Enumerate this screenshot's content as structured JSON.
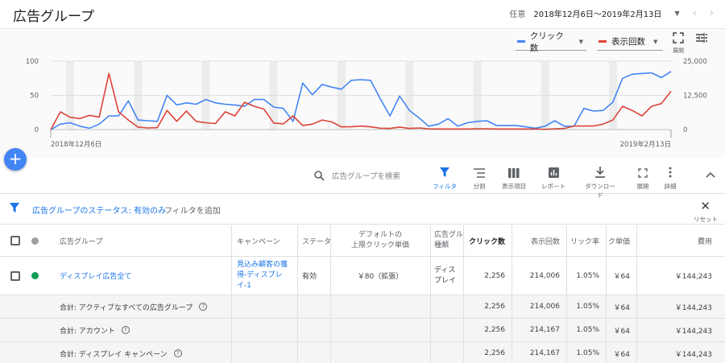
{
  "header": {
    "title": "広告グループ",
    "date_label": "任意",
    "date_range": "2018年12月6日～2019年2月13日"
  },
  "chart": {
    "metric1": "クリック数",
    "metric2": "表示回数",
    "expand_label": "展開",
    "start_label": "2018年12月6日",
    "end_label": "2019年2月13日"
  },
  "chart_data": {
    "type": "line",
    "series": [
      {
        "name": "クリック数",
        "axis": "left",
        "color": "#4285f4",
        "values": [
          0,
          8,
          10,
          5,
          2,
          8,
          20,
          20,
          42,
          14,
          13,
          12,
          50,
          36,
          39,
          37,
          44,
          39,
          37,
          36,
          34,
          44,
          44,
          33,
          31,
          12,
          68,
          51,
          66,
          62,
          59,
          72,
          73,
          72,
          45,
          20,
          49,
          28,
          17,
          5,
          8,
          16,
          5,
          10,
          12,
          13,
          6,
          6,
          6,
          4,
          2,
          5,
          13,
          5,
          5,
          31,
          27,
          28,
          40,
          75,
          81,
          82,
          83,
          76,
          85
        ]
      },
      {
        "name": "表示回数",
        "axis": "right",
        "color": "#db4437",
        "values": [
          0,
          6500,
          4500,
          4000,
          5200,
          4600,
          20500,
          6500,
          3500,
          900,
          600,
          700,
          7000,
          3000,
          6800,
          3000,
          2500,
          2200,
          6500,
          5000,
          10000,
          8500,
          7500,
          2400,
          2100,
          5000,
          1500,
          2000,
          3500,
          2800,
          1000,
          1000,
          1300,
          1000,
          500,
          400,
          900,
          400,
          600,
          300,
          200,
          200,
          200,
          200,
          300,
          300,
          200,
          200,
          200,
          200,
          200,
          100,
          300,
          400,
          1300,
          1300,
          1300,
          2000,
          3500,
          8500,
          7000,
          5000,
          8500,
          9500,
          14000
        ]
      }
    ],
    "left_ticks": [
      "0",
      "50",
      "100"
    ],
    "right_ticks": [
      "0",
      "12,500",
      "25,000"
    ],
    "ylim_left": [
      0,
      100
    ],
    "ylim_right": [
      0,
      25000
    ]
  },
  "toolbar": {
    "search_placeholder": "広告グループを検索",
    "filter": "フィルタ",
    "segment": "分割",
    "columns": "表示項目",
    "reports": "レポート",
    "download": "ダウンロード",
    "expand": "展開",
    "more": "詳細"
  },
  "filter_bar": {
    "chip": "広告グループのステータス: 有効のみ",
    "add": "フィルタを追加",
    "reset": "リセット"
  },
  "table": {
    "headers": {
      "ad_group": "広告グループ",
      "campaign": "キャンペーン",
      "status": "ステータ",
      "bid_line1": "デフォルトの",
      "bid_line2": "上限クリック単価",
      "type_line1": "広告グル",
      "type_line2": "種類",
      "clicks": "クリック数",
      "impressions": "表示回数",
      "ctr": "リック率",
      "cpc": "ク単価",
      "cost": "費用"
    },
    "row": {
      "ad_group": "ディスプレイ広告全て",
      "campaign_l1": "見込み顧客の獲",
      "campaign_l2": "得-ディスプレ",
      "campaign_l3": "イ-1",
      "status": "有効",
      "bid": "￥80（拡張）",
      "type_l1": "ディス",
      "type_l2": "プレイ",
      "clicks": "2,256",
      "impressions": "214,006",
      "ctr": "1.05%",
      "cpc": "￥64",
      "cost": "￥144,243"
    },
    "totals": [
      {
        "label": "合計: アクティブなすべての広告グループ",
        "clicks": "2,256",
        "impressions": "214,006",
        "ctr": "1.05%",
        "cpc": "￥64",
        "cost": "￥144,243"
      },
      {
        "label": "合計: アカウント",
        "clicks": "2,256",
        "impressions": "214,167",
        "ctr": "1.05%",
        "cpc": "￥64",
        "cost": "￥144,243"
      },
      {
        "label": "合計: ディスプレイ キャンペーン",
        "clicks": "2,256",
        "impressions": "214,167",
        "ctr": "1.05%",
        "cpc": "￥64",
        "cost": "￥144,243"
      }
    ]
  },
  "colors": {
    "accent": "#1a73e8",
    "clicks_line": "#4285f4",
    "impressions_line": "#db4437",
    "status_active": "#0f9d58"
  }
}
